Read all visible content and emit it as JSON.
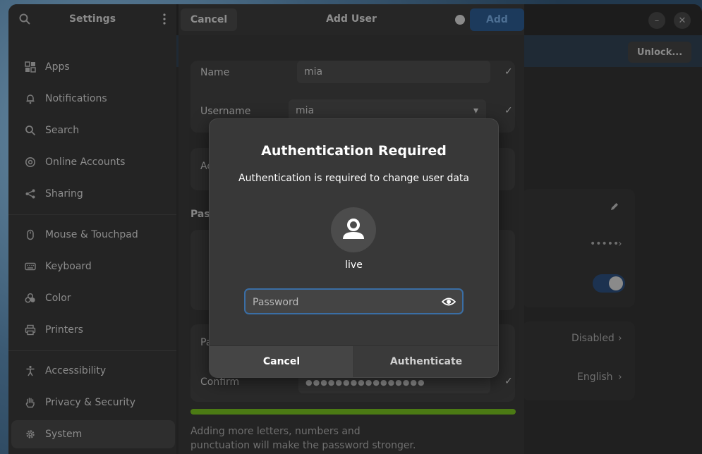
{
  "sidebar": {
    "title": "Settings",
    "items": [
      {
        "label": "Apps",
        "icon": "apps-icon"
      },
      {
        "label": "Notifications",
        "icon": "bell-icon"
      },
      {
        "label": "Search",
        "icon": "search-icon"
      },
      {
        "label": "Online Accounts",
        "icon": "at-icon"
      },
      {
        "label": "Sharing",
        "icon": "share-icon"
      },
      {
        "label": "Mouse & Touchpad",
        "icon": "mouse-icon"
      },
      {
        "label": "Keyboard",
        "icon": "keyboard-icon"
      },
      {
        "label": "Color",
        "icon": "palette-icon"
      },
      {
        "label": "Printers",
        "icon": "printer-icon"
      },
      {
        "label": "Accessibility",
        "icon": "accessibility-icon"
      },
      {
        "label": "Privacy & Security",
        "icon": "hand-icon"
      },
      {
        "label": "System",
        "icon": "gear-icon"
      }
    ]
  },
  "background": {
    "unlock_label": "Unlock...",
    "password_dots": "•••••",
    "autologin_value": "Disabled",
    "language_value": "English"
  },
  "add_user": {
    "title": "Add User",
    "cancel_label": "Cancel",
    "add_label": "Add",
    "name_label": "Name",
    "name_value": "mia",
    "username_label": "Username",
    "username_value": "mia",
    "account_label_partial": "Ac",
    "password_section_partial": "Pass",
    "password_label_partial": "Pa",
    "confirm_label": "Confirm",
    "confirm_dots": "●●●●●●●●●●●●●●●●",
    "strength_hint": "Adding more letters, numbers and punctuation will make the password stronger."
  },
  "auth_dialog": {
    "title": "Authentication Required",
    "description": "Authentication is required to change user data",
    "user": "live",
    "password_placeholder": "Password",
    "cancel_label": "Cancel",
    "authenticate_label": "Authenticate"
  },
  "colors": {
    "accent": "#3a6ea5",
    "strength_bar": "#4b7a14"
  }
}
